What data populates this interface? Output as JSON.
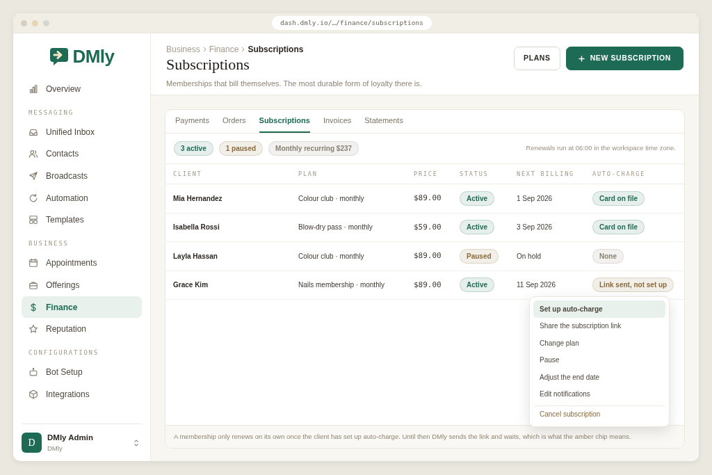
{
  "browser": {
    "url": "dash.dmly.io/…/finance/subscriptions"
  },
  "brand": {
    "name": "DMly"
  },
  "sidebar": {
    "sections": [
      {
        "items": [
          {
            "label": "Overview",
            "selected": false
          }
        ]
      },
      {
        "title": "MESSAGING",
        "items": [
          {
            "label": "Unified Inbox",
            "selected": false
          },
          {
            "label": "Contacts",
            "selected": false
          },
          {
            "label": "Broadcasts",
            "selected": false
          },
          {
            "label": "Automation",
            "selected": false
          },
          {
            "label": "Templates",
            "selected": false
          }
        ]
      },
      {
        "title": "BUSINESS",
        "items": [
          {
            "label": "Appointments",
            "selected": false
          },
          {
            "label": "Offerings",
            "selected": false
          },
          {
            "label": "Finance",
            "selected": true
          },
          {
            "label": "Reputation",
            "selected": false
          }
        ]
      },
      {
        "title": "CONFIGURATIONS",
        "items": [
          {
            "label": "Bot Setup",
            "selected": false
          },
          {
            "label": "Integrations",
            "selected": false
          }
        ]
      }
    ],
    "user": {
      "initial": "D",
      "name": "DMly Admin",
      "workspace": "DMly"
    }
  },
  "header": {
    "breadcrumb": [
      "Business",
      "Finance",
      "Subscriptions"
    ],
    "title": "Subscriptions",
    "subtitle": "Memberships that bill themselves. The most durable form of loyalty there is.",
    "buttons": [
      {
        "label": "PLANS",
        "kind": "secondary"
      },
      {
        "label": "NEW SUBSCRIPTION",
        "kind": "primary"
      }
    ]
  },
  "tabs": [
    {
      "label": "Payments",
      "selected": false
    },
    {
      "label": "Orders",
      "selected": false
    },
    {
      "label": "Subscriptions",
      "selected": true
    },
    {
      "label": "Invoices",
      "selected": false
    },
    {
      "label": "Statements",
      "selected": false
    }
  ],
  "summary_chips": [
    {
      "label": "3 active",
      "color": "#1d6b55"
    },
    {
      "label": "1 paused",
      "color": "#8a6a3a"
    },
    {
      "label": "Monthly recurring $237",
      "color": "#8a8172"
    }
  ],
  "note": "Renewals run at 06:00 in the workspace time zone.",
  "table": {
    "columns": [
      "CLIENT",
      "PLAN",
      "PRICE",
      "STATUS",
      "NEXT BILLING",
      "AUTO-CHARGE"
    ],
    "rows": [
      {
        "client": "Mia Hernandez",
        "plan": "Colour club · monthly",
        "price": "$89.00",
        "status": {
          "label": "Active",
          "color": "#1d6b55"
        },
        "next_billing": "1 Sep 2026",
        "auto_charge": {
          "label": "Card on file",
          "color": "#1d6b55"
        }
      },
      {
        "client": "Isabella Rossi",
        "plan": "Blow-dry pass · monthly",
        "price": "$59.00",
        "status": {
          "label": "Active",
          "color": "#1d6b55"
        },
        "next_billing": "3 Sep 2026",
        "auto_charge": {
          "label": "Card on file",
          "color": "#1d6b55"
        }
      },
      {
        "client": "Layla Hassan",
        "plan": "Colour club · monthly",
        "price": "$89.00",
        "status": {
          "label": "Paused",
          "color": "#8a6a3a"
        },
        "next_billing": "On hold",
        "auto_charge": {
          "label": "None",
          "color": "#8a8172"
        }
      },
      {
        "client": "Grace Kim",
        "plan": "Nails membership · monthly",
        "price": "$89.00",
        "status": {
          "label": "Active",
          "color": "#1d6b55"
        },
        "next_billing": "11 Sep 2026",
        "auto_charge": {
          "label": "Link sent, not set up",
          "color": "#8a6a3a"
        }
      }
    ]
  },
  "context_menu": {
    "items": [
      {
        "label": "Set up auto-charge",
        "selected": true,
        "kind": "action"
      },
      {
        "label": "Share the subscription link",
        "selected": false,
        "kind": "action"
      },
      {
        "label": "Change plan",
        "selected": false,
        "kind": "action"
      },
      {
        "label": "Pause",
        "selected": false,
        "kind": "action"
      },
      {
        "label": "Adjust the end date",
        "selected": false,
        "kind": "action"
      },
      {
        "label": "Edit notifications",
        "selected": false,
        "kind": "action"
      },
      {
        "label": "Cancel subscription",
        "selected": false,
        "kind": "danger"
      }
    ]
  },
  "footer": "A membership only renews on its own once the client has set up auto-charge. Until then DMly sends the link and waits, which is what the amber chip means."
}
